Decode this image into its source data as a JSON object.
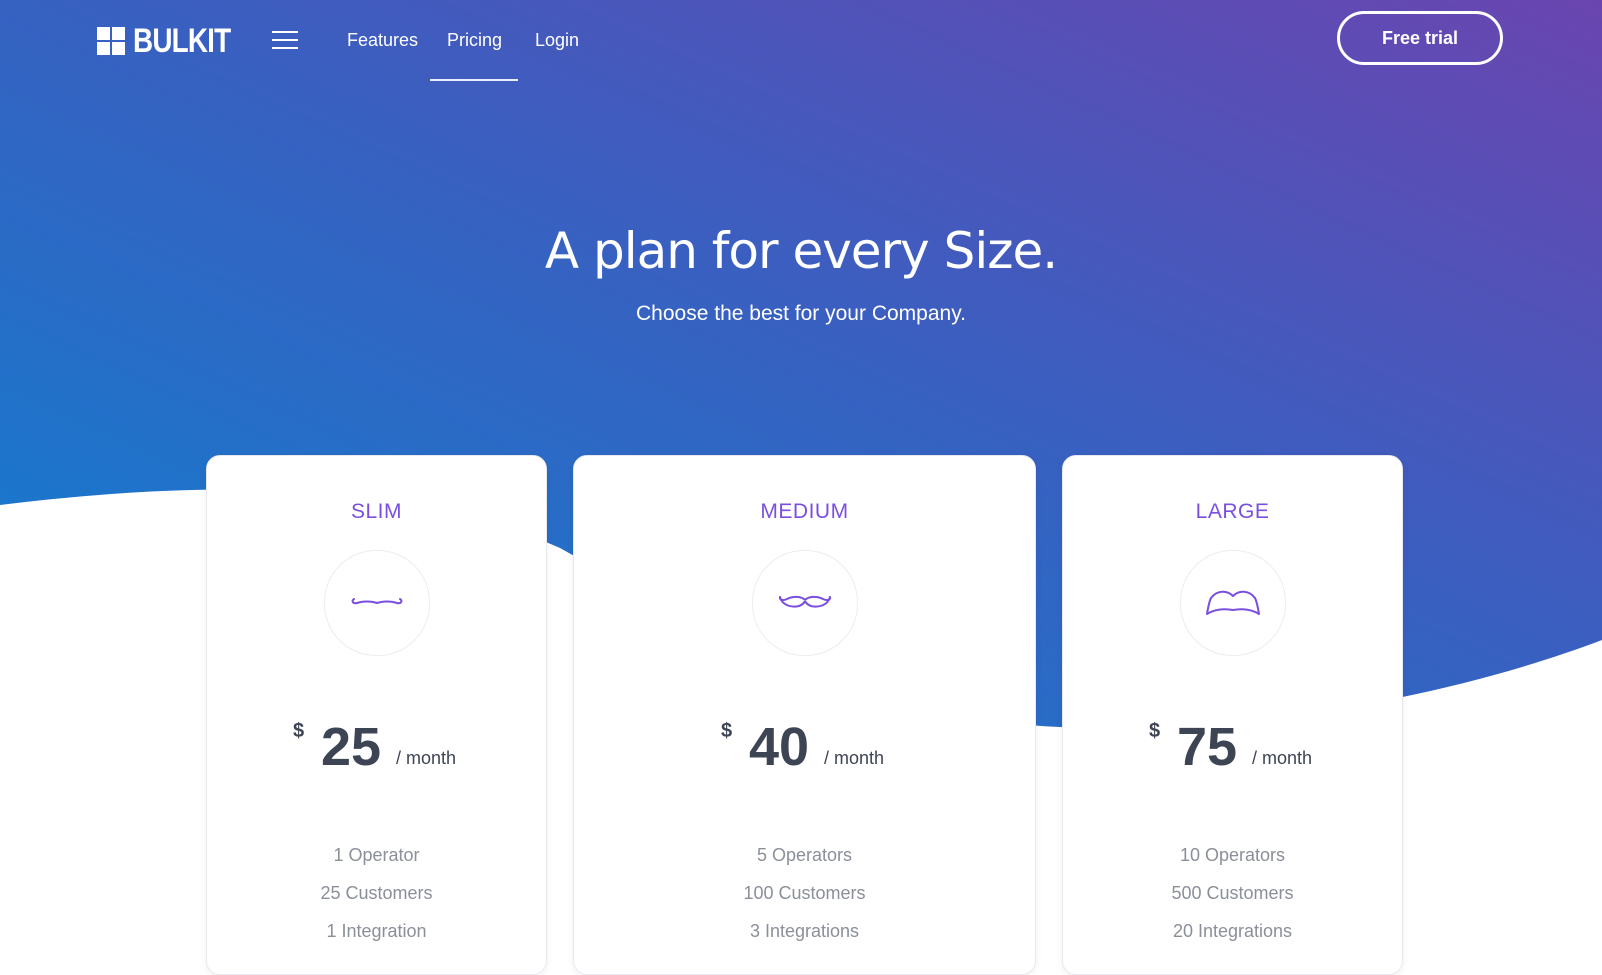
{
  "brand": {
    "name": "BULKIT"
  },
  "colors": {
    "hero_gradient_start": "#0f7fd0",
    "hero_gradient_mid": "#3a5fc0",
    "hero_gradient_end": "#6a45b0",
    "plan_accent": "#7a4fe0",
    "price_text": "#3d4454",
    "feature_text": "#8a8f99"
  },
  "nav": {
    "menu_icon": "hamburger-menu-icon",
    "links": [
      {
        "label": "Features",
        "active": false
      },
      {
        "label": "Pricing",
        "active": true
      },
      {
        "label": "Login",
        "active": false
      }
    ],
    "cta_label": "Free trial"
  },
  "hero": {
    "title": "A plan for every Size.",
    "subtitle": "Choose the best for your Company."
  },
  "plans": [
    {
      "name": "SLIM",
      "icon": "thin-mustache-icon",
      "currency": "$",
      "amount": "25",
      "period": "/ month",
      "features": [
        "1 Operator",
        "25 Customers",
        "1 Integration"
      ]
    },
    {
      "name": "MEDIUM",
      "icon": "curly-mustache-icon",
      "currency": "$",
      "amount": "40",
      "period": "/ month",
      "features": [
        "5 Operators",
        "100 Customers",
        "3 Integrations"
      ]
    },
    {
      "name": "LARGE",
      "icon": "big-mustache-icon",
      "currency": "$",
      "amount": "75",
      "period": "/ month",
      "features": [
        "10 Operators",
        "500 Customers",
        "20 Integrations"
      ]
    }
  ]
}
